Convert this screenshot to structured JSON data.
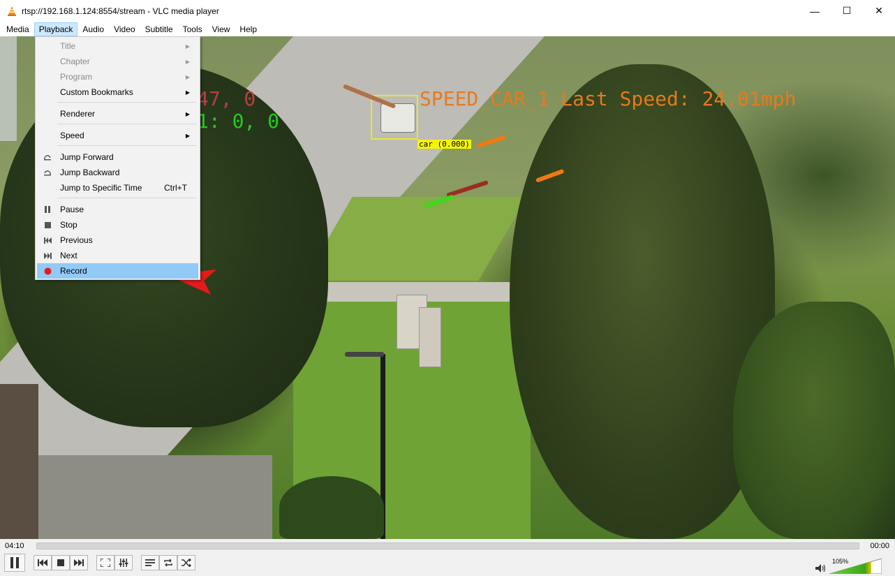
{
  "window": {
    "title": "rtsp://192.168.1.124:8554/stream - VLC media player",
    "app_icon": "vlc-cone-icon",
    "controls": {
      "minimize": "—",
      "maximize": "☐",
      "close": "✕"
    }
  },
  "menubar": {
    "items": [
      "Media",
      "Playback",
      "Audio",
      "Video",
      "Subtitle",
      "Tools",
      "View",
      "Help"
    ],
    "active": "Playback"
  },
  "playback_menu": {
    "title": "Title",
    "chapter": "Chapter",
    "program": "Program",
    "custom_bookmarks": "Custom Bookmarks",
    "renderer": "Renderer",
    "speed": "Speed",
    "jump_forward": "Jump Forward",
    "jump_backward": "Jump Backward",
    "jump_specific": "Jump to Specific Time",
    "jump_specific_shortcut": "Ctrl+T",
    "pause": "Pause",
    "stop": "Stop",
    "previous": "Previous",
    "next": "Next",
    "record": "Record",
    "highlighted": "Record"
  },
  "video_overlay": {
    "speed_text": "SPEED_CAR_1 Last Speed: 24.01mph",
    "detection_label": "car (0.000)",
    "hidden_text_1": "47, 0",
    "hidden_text_2": "1: 0, 0",
    "colors": {
      "speed_text": "#e67a1c",
      "label_bg": "#f5f500",
      "green_text": "#22cc22",
      "red_text": "#b84040"
    }
  },
  "controls": {
    "elapsed": "04:10",
    "remaining": "00:00",
    "volume": "105%",
    "progress": 0.0
  }
}
